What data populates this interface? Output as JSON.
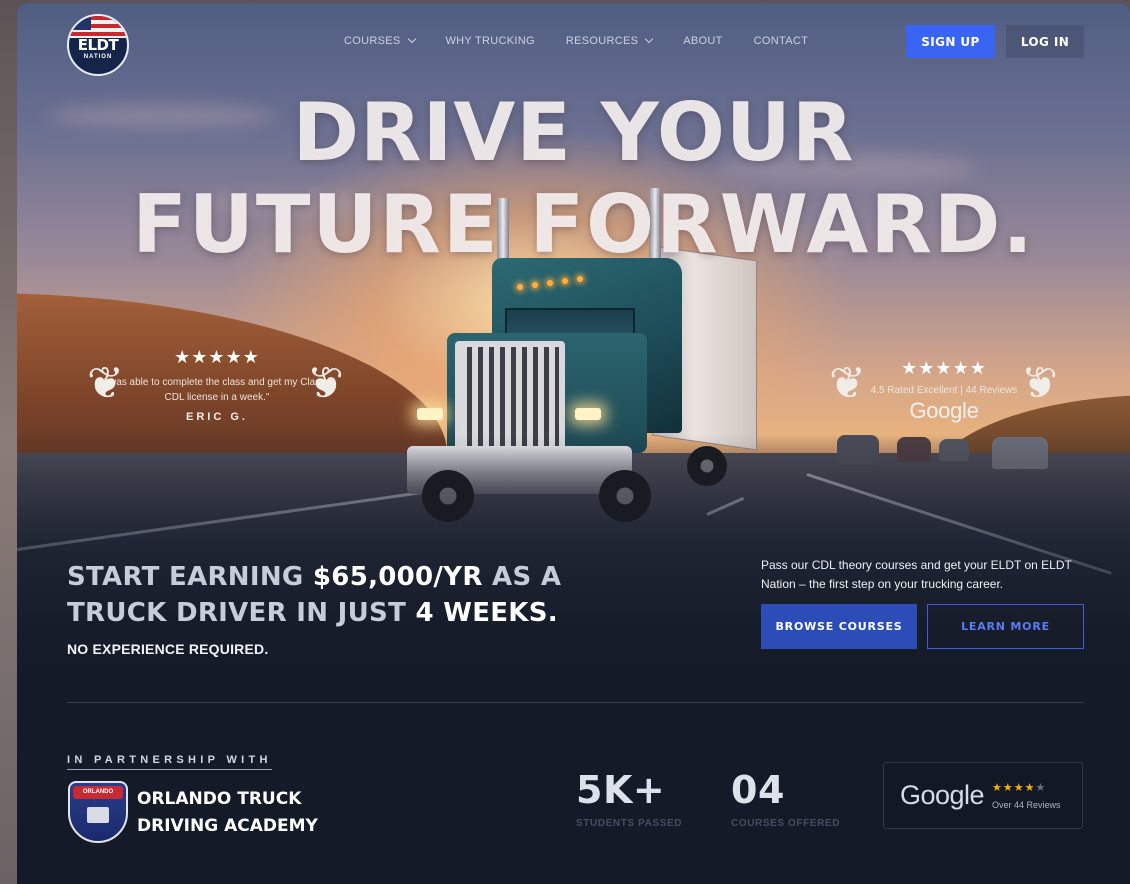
{
  "brand": {
    "logo_text": "ELDT",
    "logo_sub": "NATION"
  },
  "nav": {
    "items": [
      {
        "label": "COURSES",
        "has_dropdown": true
      },
      {
        "label": "WHY TRUCKING",
        "has_dropdown": false
      },
      {
        "label": "RESOURCES",
        "has_dropdown": true
      },
      {
        "label": "ABOUT",
        "has_dropdown": false
      },
      {
        "label": "CONTACT",
        "has_dropdown": false
      }
    ],
    "signup_label": "SIGN UP",
    "login_label": "LOG IN"
  },
  "hero": {
    "headline_line1": "DRIVE YOUR",
    "headline_line2": "FUTURE FORWARD."
  },
  "testimonial": {
    "stars": "★★★★★",
    "quote": "\"I was able to complete the class and get my Class A CDL license in a week.\"",
    "author": "ERIC G."
  },
  "rating": {
    "stars": "★★★★★",
    "text": "4.5 Rated Excellent | 44 Reviews",
    "provider": "Google"
  },
  "pitch": {
    "part1": "START EARNING ",
    "salary": "$65,000/YR",
    "part2": " AS A TRUCK DRIVER IN JUST ",
    "weeks": "4 WEEKS.",
    "no_experience": "NO EXPERIENCE REQUIRED.",
    "sub_copy": "Pass our CDL theory courses and get your ELDT on ELDT Nation – the first step on your trucking career.",
    "browse_label": "BROWSE COURSES",
    "learn_label": "LEARN MORE"
  },
  "partner": {
    "label": "IN PARTNERSHIP WITH",
    "shield_text": "ORLANDO",
    "name_line1": "ORLANDO TRUCK",
    "name_line2": "DRIVING ACADEMY"
  },
  "stats": [
    {
      "value": "5K+",
      "label": "STUDENTS PASSED"
    },
    {
      "value": "04",
      "label": "COURSES OFFERED"
    }
  ],
  "google_card": {
    "word": "Google",
    "stars_filled": "★★★★",
    "stars_empty": "★",
    "rating": 4,
    "reviews": "Over 44 Reviews"
  },
  "colors": {
    "accent": "#3a64f2",
    "browse_bg": "#2c4db8",
    "page_bg": "#141a27",
    "star_gold": "#f0b400"
  },
  "icons": [
    "chevron-down-icon",
    "laurel-icon",
    "star-icon",
    "truck-icon",
    "shield-logo-icon"
  ]
}
